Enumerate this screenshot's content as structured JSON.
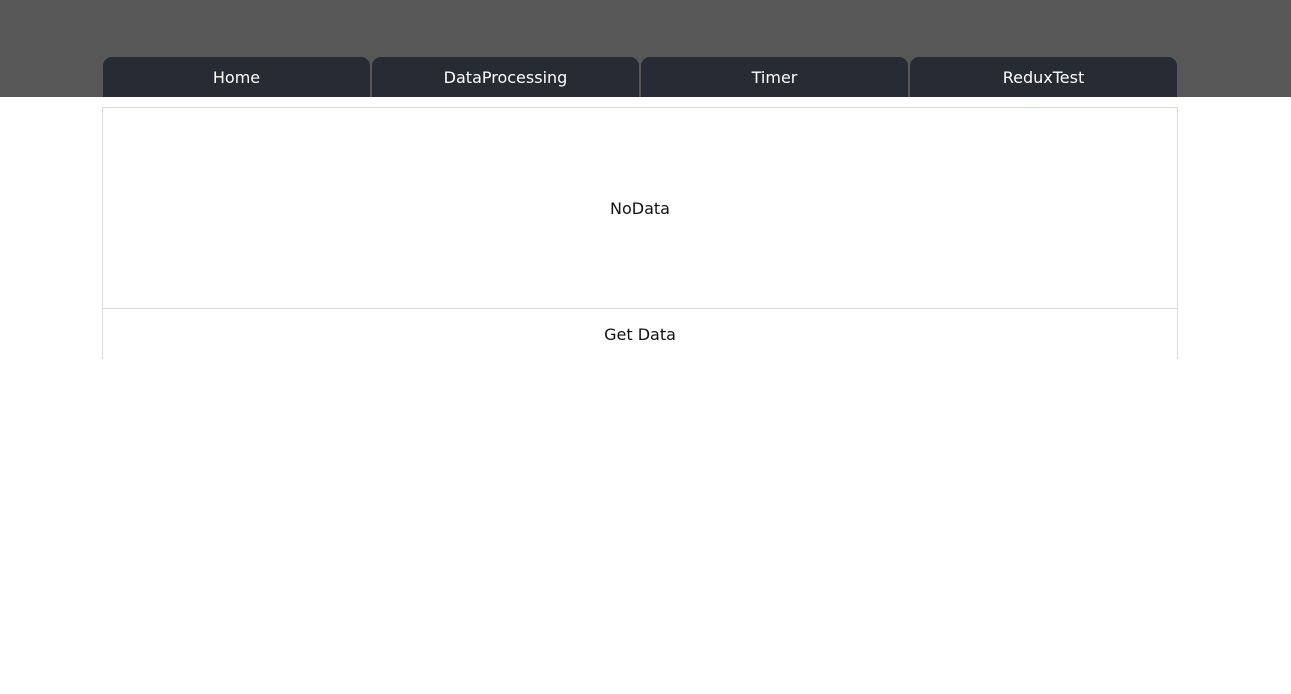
{
  "nav": {
    "tabs": [
      {
        "label": "Home"
      },
      {
        "label": "DataProcessing"
      },
      {
        "label": "Timer"
      },
      {
        "label": "ReduxTest"
      }
    ]
  },
  "main": {
    "status_text": "NoData",
    "get_data_label": "Get Data"
  },
  "colors": {
    "header_bg": "#575757",
    "tab_bg": "#272b33",
    "tab_text": "#ffffff",
    "panel_border": "#dcdcdc"
  }
}
